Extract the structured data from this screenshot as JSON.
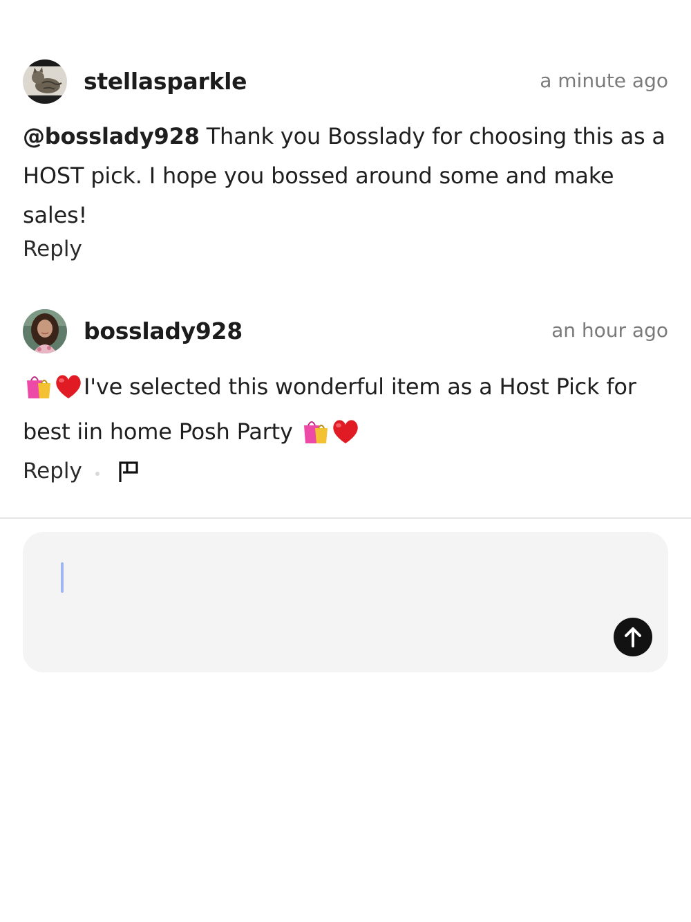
{
  "comments": [
    {
      "username": "stellasparkle",
      "timestamp": "a minute ago",
      "mention": "@bosslady928",
      "text": " Thank you Bosslady for choosing this as a HOST pick. I hope you bossed around some and make sales!",
      "reply_label": "Reply",
      "avatar_icon": "cat-avatar"
    },
    {
      "username": "bosslady928",
      "timestamp": "an hour ago",
      "text_part1": "I've selected this wonderful item as a Host Pick for best iin home  Posh Party ",
      "reply_label": "Reply",
      "avatar_icon": "woman-avatar",
      "emojis": [
        "shopping-bags-emoji",
        "red-heart-emoji"
      ]
    }
  ],
  "composer": {
    "value": "",
    "send_icon": "arrow-up-icon"
  }
}
